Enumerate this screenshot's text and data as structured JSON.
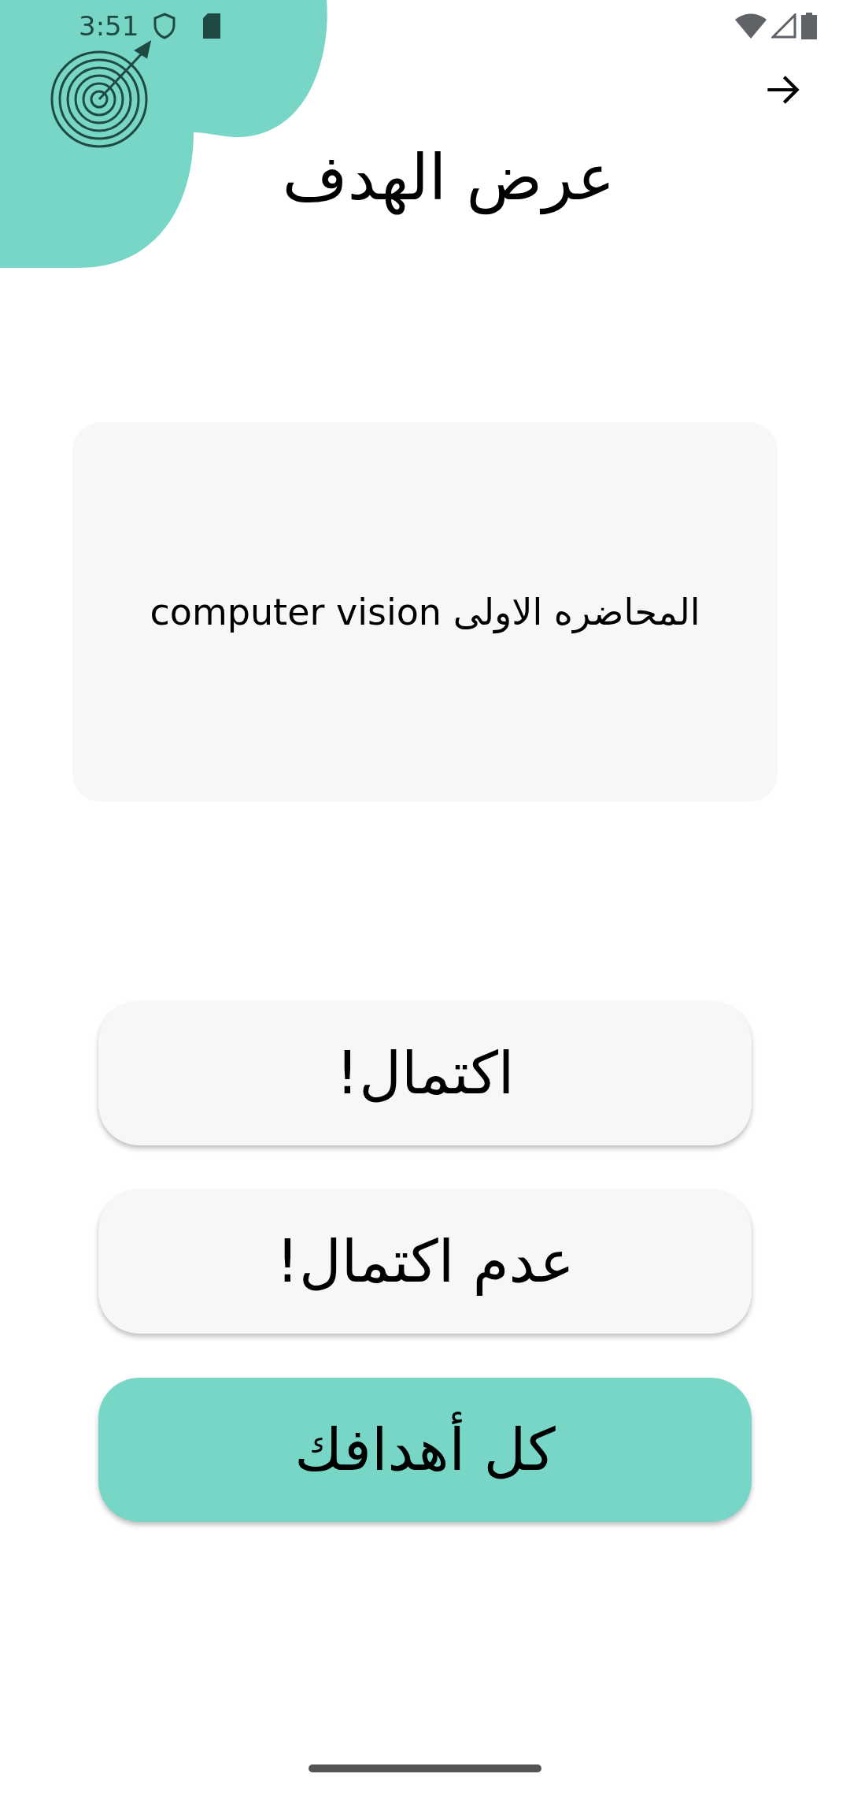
{
  "status_bar": {
    "time": "3:51"
  },
  "header": {
    "title": "عرض الهدف"
  },
  "goal_card": {
    "text": "المحاضره الاولى computer vision"
  },
  "buttons": [
    {
      "label": "اكتمال!",
      "kind": "secondary"
    },
    {
      "label": "عدم اكتمال!",
      "kind": "secondary"
    },
    {
      "label": "كل أهدافك",
      "kind": "primary"
    }
  ]
}
